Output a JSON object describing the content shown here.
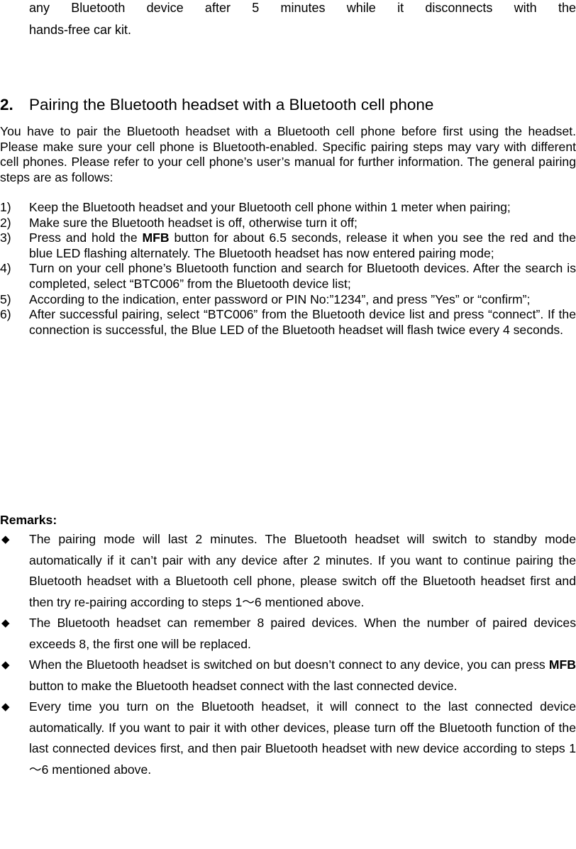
{
  "continuation": {
    "line1": "any Bluetooth device after 5 minutes while it disconnects with the",
    "line2": "hands-free car kit."
  },
  "section": {
    "number": "2.",
    "title": "Pairing the Bluetooth headset with a Bluetooth cell phone",
    "intro": "You have to pair the Bluetooth headset with a Bluetooth cell phone before first using the headset. Please make sure your cell phone is Bluetooth-enabled. Specific pairing steps may vary with different cell phones. Please refer to your cell phone’s user’s manual for further information. The general pairing steps are as follows:",
    "steps": [
      {
        "num": "1)",
        "pre": "Keep the Bluetooth headset and your Bluetooth cell phone within 1 meter when pairing;",
        "bold": "",
        "post": ""
      },
      {
        "num": "2)",
        "pre": "Make sure the Bluetooth headset is off, otherwise turn it off;",
        "bold": "",
        "post": ""
      },
      {
        "num": "3)",
        "pre": "Press and hold the ",
        "bold": "MFB",
        "post": " button for about 6.5 seconds, release it when you see the red and the blue LED flashing alternately. The Bluetooth headset has now entered pairing mode;"
      },
      {
        "num": "4)",
        "pre": "Turn on your cell phone’s Bluetooth function and search for Bluetooth devices. After the search is completed, select “BTC006” from the Bluetooth device list;",
        "bold": "",
        "post": ""
      },
      {
        "num": "5)",
        "pre": "According to the indication, enter password or PIN No:”1234”, and press ”Yes” or “confirm”;",
        "bold": "",
        "post": ""
      },
      {
        "num": "6)",
        "pre": "After successful pairing, select “BTC006” from the Bluetooth device list and press “connect”. If the connection is successful, the Blue LED of the Bluetooth headset will flash twice every 4 seconds.",
        "bold": "",
        "post": ""
      }
    ]
  },
  "remarks": {
    "title": "Remarks:",
    "bullet_glyph": "◆",
    "items": [
      {
        "pre": "The pairing mode will last 2 minutes. The Bluetooth headset will switch to standby mode automatically if it can’t pair with any device after 2 minutes. If you want to continue pairing the Bluetooth headset with a Bluetooth cell phone, please switch off the Bluetooth headset first and then try re-pairing according to steps 1～6 mentioned above.",
        "bold": "",
        "post": ""
      },
      {
        "pre": "The Bluetooth headset can remember 8 paired devices. When the number of paired devices exceeds 8, the first one will be replaced.",
        "bold": "",
        "post": ""
      },
      {
        "pre": "When the Bluetooth headset is switched on but doesn’t connect to any device, you can press ",
        "bold": "MFB",
        "post": " button to make the Bluetooth headset connect with the last connected device."
      },
      {
        "pre": "Every time you turn on the Bluetooth headset, it will connect to the last connected device automatically. If you want to pair it with other devices, please turn off the Bluetooth function of the last connected devices first, and then pair Bluetooth headset with new device according to steps 1～6 mentioned above.",
        "bold": "",
        "post": ""
      }
    ]
  }
}
